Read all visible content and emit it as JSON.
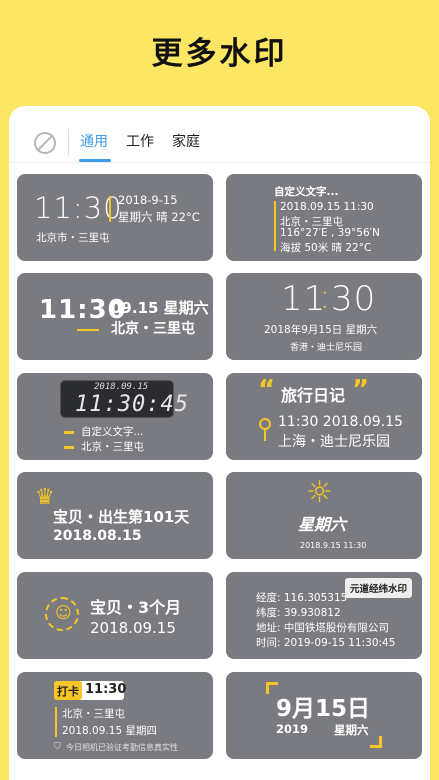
{
  "title": "更多水印",
  "tabs": [
    {
      "label": "通用",
      "active": true
    },
    {
      "label": "工作",
      "active": false
    },
    {
      "label": "家庭",
      "active": false
    }
  ],
  "colors": {
    "background": "#FCE663",
    "accent": "#3D9BE9",
    "card": "#7a7b80",
    "highlight": "#F6C626"
  },
  "cards": {
    "c1": {
      "time": "11:30",
      "date": "2018-9-15",
      "weekday_weather": "星期六 晴 22°C",
      "location": "北京市・三里屯"
    },
    "c2": {
      "title": "自定义文字...",
      "datetime": "2018.09.15 11:30",
      "location": "北京・三里屯",
      "coords": "116°27′E , 39°56′N",
      "altitude_weather": "海拔 50米  晴 22°C"
    },
    "c3": {
      "time": "11:30",
      "date_week": "09.15 星期六",
      "location": "北京・三里屯"
    },
    "c4": {
      "time_h": "11",
      "time_sep": ":",
      "time_m": "30",
      "date": "2018年9月15日  星期六",
      "location": "香港・迪士尼乐园"
    },
    "c5": {
      "lcd_date": "2018.09.15",
      "lcd_time": "11:30:45",
      "line1": "自定义文字...",
      "line2": "北京・三里屯"
    },
    "c6": {
      "quote_open": "“",
      "title": "旅行日记",
      "quote_close": "”",
      "datetime": "11:30  2018.09.15",
      "location": "上海・迪士尼乐园"
    },
    "c7": {
      "title": "宝贝・出生第101天",
      "date": "2018.08.15"
    },
    "c8": {
      "weekday": "星期六",
      "datetime": "2018.9.15  11:30"
    },
    "c9": {
      "title": "宝贝・3个月",
      "date": "2018.09.15"
    },
    "c10": {
      "badge": "元道经纬水印",
      "lon": "经度: 116.305315",
      "lat": "纬度: 39.930812",
      "addr": "地址: 中国铁塔股份有限公司",
      "time": "时间: 2019-09-15  11:30:45"
    },
    "c11": {
      "tag": "打卡",
      "time": "11:30",
      "location": "北京・三里屯",
      "date": "2018.09.15  星期四",
      "verify": "今日相机已验证考勤信息真实性"
    },
    "c12": {
      "date": "9月15日",
      "year": "2019",
      "weekday": "星期六"
    }
  }
}
